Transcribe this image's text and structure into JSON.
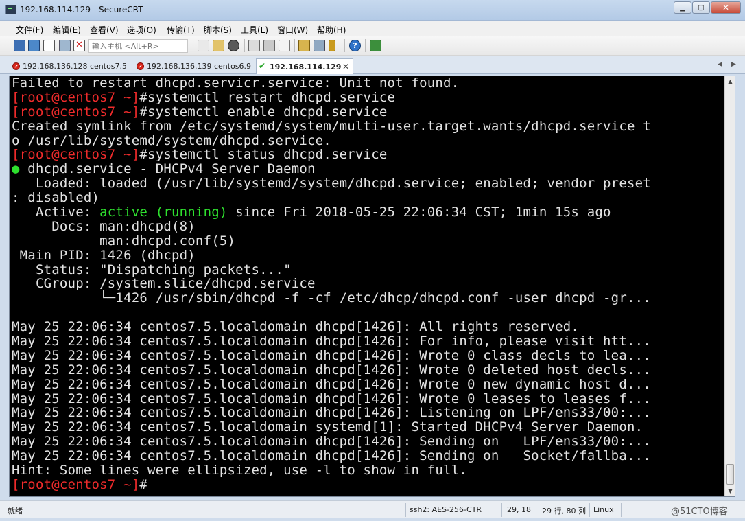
{
  "window": {
    "title": "192.168.114.129 - SecureCRT",
    "minimize_glyph": "▁",
    "maximize_glyph": "▢",
    "close_glyph": "✕"
  },
  "menu": [
    "文件(F)",
    "编辑(E)",
    "查看(V)",
    "选项(O)",
    "传输(T)",
    "脚本(S)",
    "工具(L)",
    "窗口(W)",
    "帮助(H)"
  ],
  "toolbar": {
    "host_placeholder": "输入主机 <Alt+R>",
    "icons": [
      "connect-icon",
      "quick-connect-icon",
      "connect-in-tab-icon",
      "reconnect-icon",
      "disconnect-icon",
      "copy-icon",
      "paste-icon",
      "find-icon",
      "print-icon",
      "print-setup-icon",
      "log-icon",
      "session-options-icon",
      "global-options-icon",
      "keymap-icon",
      "help-icon",
      "sftp-icon"
    ]
  },
  "tabs": [
    {
      "label": "192.168.136.128 centos7.5",
      "status": "error"
    },
    {
      "label": "192.168.136.139 centos6.9",
      "status": "error"
    },
    {
      "label": "192.168.114.129",
      "status": "connected",
      "active": true
    }
  ],
  "tab_nav": {
    "prev": "◀",
    "next": "▶"
  },
  "terminal": {
    "lines": [
      [
        {
          "t": "Failed to restart dhcpd.servicr.service: Unit not found."
        }
      ],
      [
        {
          "t": "[root@centos7 ~]",
          "c": "red"
        },
        {
          "t": "#systemctl restart dhcpd.service"
        }
      ],
      [
        {
          "t": "[root@centos7 ~]",
          "c": "red"
        },
        {
          "t": "#systemctl enable dhcpd.service"
        }
      ],
      [
        {
          "t": "Created symlink from /etc/systemd/system/multi-user.target.wants/dhcpd.service t"
        }
      ],
      [
        {
          "t": "o /usr/lib/systemd/system/dhcpd.service."
        }
      ],
      [
        {
          "t": "[root@centos7 ~]",
          "c": "red"
        },
        {
          "t": "#systemctl status dhcpd.service"
        }
      ],
      [
        {
          "t": "●",
          "c": "green"
        },
        {
          "t": " dhcpd.service - DHCPv4 Server Daemon"
        }
      ],
      [
        {
          "t": "   Loaded: loaded (/usr/lib/systemd/system/dhcpd.service; enabled; vendor preset"
        }
      ],
      [
        {
          "t": ": disabled)"
        }
      ],
      [
        {
          "t": "   Active: "
        },
        {
          "t": "active (running)",
          "c": "green"
        },
        {
          "t": " since Fri 2018-05-25 22:06:34 CST; 1min 15s ago"
        }
      ],
      [
        {
          "t": "     Docs: man:dhcpd(8)"
        }
      ],
      [
        {
          "t": "           man:dhcpd.conf(5)"
        }
      ],
      [
        {
          "t": " Main PID: 1426 (dhcpd)"
        }
      ],
      [
        {
          "t": "   Status: \"Dispatching packets...\""
        }
      ],
      [
        {
          "t": "   CGroup: /system.slice/dhcpd.service"
        }
      ],
      [
        {
          "t": "           └─1426 /usr/sbin/dhcpd -f -cf /etc/dhcp/dhcpd.conf -user dhcpd -gr..."
        }
      ],
      [
        {
          "t": ""
        }
      ],
      [
        {
          "t": "May 25 22:06:34 centos7.5.localdomain dhcpd[1426]: All rights reserved."
        }
      ],
      [
        {
          "t": "May 25 22:06:34 centos7.5.localdomain dhcpd[1426]: For info, please visit htt..."
        }
      ],
      [
        {
          "t": "May 25 22:06:34 centos7.5.localdomain dhcpd[1426]: Wrote 0 class decls to lea..."
        }
      ],
      [
        {
          "t": "May 25 22:06:34 centos7.5.localdomain dhcpd[1426]: Wrote 0 deleted host decls..."
        }
      ],
      [
        {
          "t": "May 25 22:06:34 centos7.5.localdomain dhcpd[1426]: Wrote 0 new dynamic host d..."
        }
      ],
      [
        {
          "t": "May 25 22:06:34 centos7.5.localdomain dhcpd[1426]: Wrote 0 leases to leases f..."
        }
      ],
      [
        {
          "t": "May 25 22:06:34 centos7.5.localdomain dhcpd[1426]: Listening on LPF/ens33/00:..."
        }
      ],
      [
        {
          "t": "May 25 22:06:34 centos7.5.localdomain systemd[1]: Started DHCPv4 Server Daemon."
        }
      ],
      [
        {
          "t": "May 25 22:06:34 centos7.5.localdomain dhcpd[1426]: Sending on   LPF/ens33/00:..."
        }
      ],
      [
        {
          "t": "May 25 22:06:34 centos7.5.localdomain dhcpd[1426]: Sending on   Socket/fallba..."
        }
      ],
      [
        {
          "t": "Hint: Some lines were ellipsized, use -l to show in full."
        }
      ],
      [
        {
          "t": "[root@centos7 ~]",
          "c": "red"
        },
        {
          "t": "#"
        }
      ]
    ],
    "colors": {
      "red": "#ee2b2b",
      "green": "#2ee02e",
      "fg": "#e2e2e2",
      "bg": "#000000"
    }
  },
  "statusbar": {
    "ready": "就绪",
    "cipher": "ssh2: AES-256-CTR",
    "cursor": "29,  18",
    "size": "29 行, 80 列",
    "os": "Linux",
    "watermark": "@51CTO博客"
  }
}
